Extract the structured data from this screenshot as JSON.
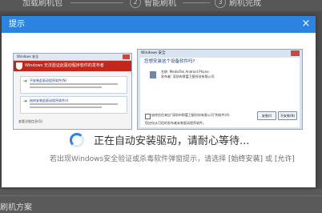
{
  "background": {
    "steps": [
      {
        "number": "",
        "label": "加载刷机包"
      },
      {
        "number": "2",
        "label": "智能刷机"
      },
      {
        "number": "3",
        "label": "刷机完成"
      }
    ],
    "bottom_text": "刷机方案"
  },
  "dialog": {
    "title": "提示",
    "close_symbol": "×",
    "accent_color": "#2c84e0",
    "left_screenshot": {
      "titlebar": "Windows 安全",
      "banner": "Windows 无法验证此驱动程序软件的发布者",
      "option1": "不安装此驱动程序软件(N)",
      "option2": "始终安装此驱动程序软件(I)",
      "footer": "查看详细信息(D)"
    },
    "right_screenshot": {
      "titlebar": "Windows 安全",
      "question": "您想安装这个设备软件吗?",
      "device_name": "名称: MediaTek Android Phone",
      "publisher": "发布者: 深圳市财富卫星科技有限公司",
      "checkbox_text": "始终信任来自\"深圳市财富卫星科技有限公司\"的软件(A).",
      "install_button": "安装(I)",
      "no_install_button": "不安装(N)",
      "note": "您应仅从可信的发布者安装驱动程序软件。"
    },
    "loading_text": "正在自动安装驱动，请耐心等待...",
    "hint": {
      "prefix": "若出现Windows安全验证或杀毒软件弹窗提示，请选择 ",
      "option1": "[始终安装]",
      "middle": " 或 ",
      "option2": "[允许]"
    }
  }
}
